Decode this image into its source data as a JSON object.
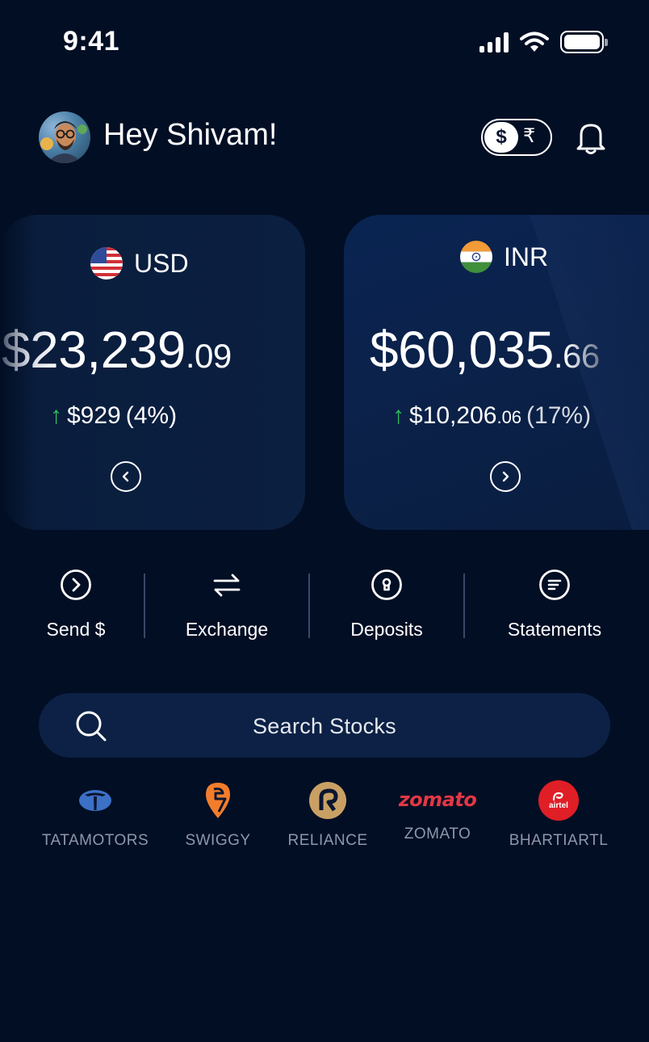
{
  "status": {
    "time": "9:41"
  },
  "header": {
    "greeting": "Hey Shivam!",
    "toggle_active": "$",
    "toggle_alt": "₹"
  },
  "cards": [
    {
      "code": "USD",
      "amount_main": "$23,239",
      "amount_cents": ".09",
      "change": "$929",
      "change_pct": "(4%)"
    },
    {
      "code": "INR",
      "amount_main": "$60,035",
      "amount_cents": ".66",
      "change_main": "$10,206",
      "change_cents": ".06",
      "change_pct": "(17%)"
    }
  ],
  "actions": [
    "Send $",
    "Exchange",
    "Deposits",
    "Statements"
  ],
  "search": {
    "placeholder": "Search Stocks"
  },
  "stocks": [
    "TATAMOTORS",
    "SWIGGY",
    "RELIANCE",
    "ZOMATO",
    "BHARTIARTL"
  ],
  "logos": {
    "zomato": "zomato",
    "airtel": "airtel"
  },
  "colors": {
    "background": "#020e24",
    "card": "#0b1f41",
    "accent_up": "#2fbf5e",
    "search_bg": "#0c2145"
  }
}
